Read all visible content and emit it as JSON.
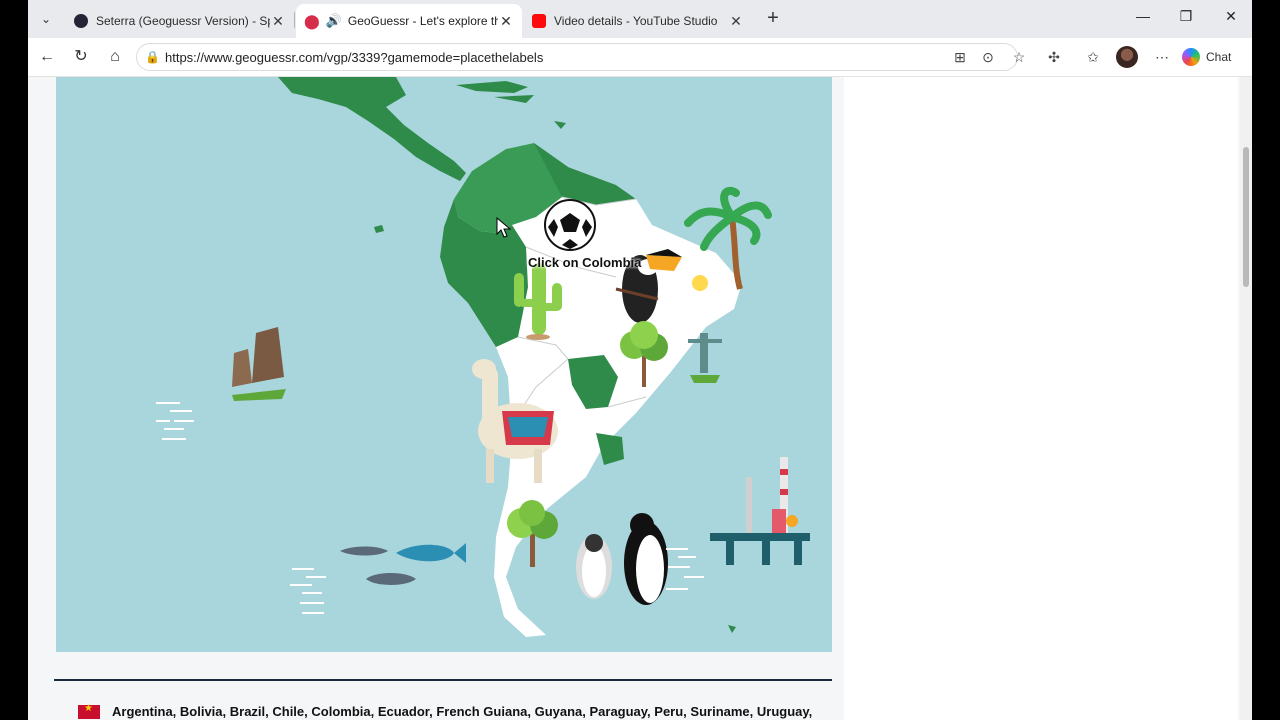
{
  "browser": {
    "tabs": [
      {
        "title": "Seterra (Geoguessr Version) - Spe",
        "favicon": "seterra-icon",
        "active": false,
        "color": "#1a1a2e"
      },
      {
        "title": "GeoGuessr - Let's explore the",
        "favicon": "location-pin-icon",
        "active": true,
        "color": "#d62d4a"
      },
      {
        "title": "Video details - YouTube Studio",
        "favicon": "youtube-icon",
        "active": false,
        "color": "#ff0000"
      }
    ],
    "url": "https://www.geoguessr.com/vgp/3339?gamemode=placethelabels",
    "chat_label": "Chat"
  },
  "map": {
    "prompt": "Click on Colombia",
    "colors": {
      "ocean": "#a9d5dc",
      "land": "#ffffff",
      "highlight": "#2e8b4a",
      "central_america": "#2e8b4a"
    },
    "decorations": [
      "soccer-ball-icon",
      "toucan-icon",
      "palm-tree-icon",
      "cactus-icon",
      "moai-icon",
      "llama-icon",
      "tree-icon",
      "christ-redeemer-icon",
      "penguin-icon",
      "fish-icon",
      "oil-platform-icon"
    ]
  },
  "footer": {
    "countries": "Argentina, Bolivia, Brazil, Chile, Colombia, Ecuador, French Guiana, Guyana, Paraguay, Peru, Suriname, Uruguay,"
  }
}
